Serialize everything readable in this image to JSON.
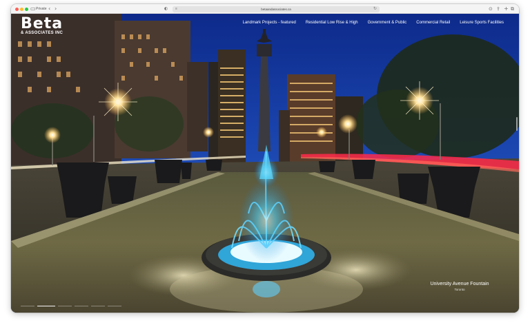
{
  "browser": {
    "tab_label": "Private",
    "url": "betaandassociates.ca",
    "back_icon": "chevron-left-icon",
    "forward_icon": "chevron-right-icon"
  },
  "site": {
    "logo_main": "Beta",
    "logo_sub": "& ASSOCIATES INC"
  },
  "nav": [
    {
      "label": "Landmark Projects - featured"
    },
    {
      "label": "Residential Low Rise & High"
    },
    {
      "label": "Government & Public"
    },
    {
      "label": "Commercial Retail"
    },
    {
      "label": "Leisure Sports Facilities"
    }
  ],
  "hero": {
    "caption_title": "University Avenue Fountain",
    "caption_subtitle": "Toronto",
    "slide_count": 6,
    "active_slide": 2
  },
  "colors": {
    "sky": "#1b3f9e",
    "fountain_glow": "#3ec8ff",
    "street_light": "#ffd27a",
    "tail_lights": "#ff2a4a"
  }
}
